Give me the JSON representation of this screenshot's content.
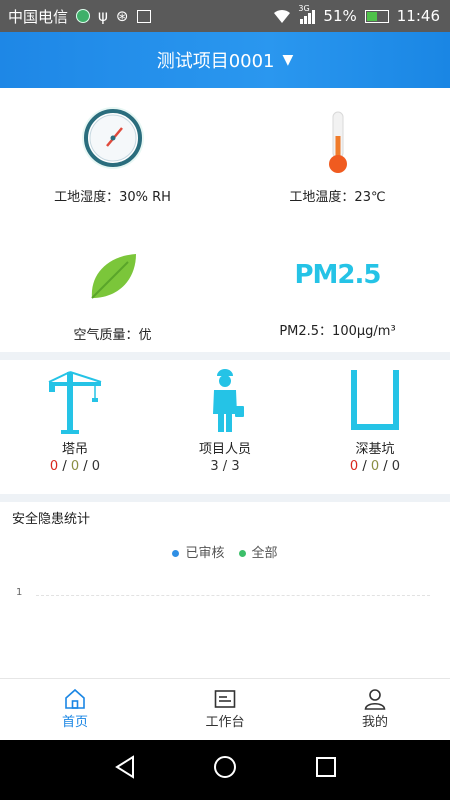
{
  "status_bar": {
    "carrier": "中国电信",
    "network": "3G",
    "battery": "51%",
    "time": "11:46"
  },
  "header": {
    "project": "测试项目0001",
    "caret": "▼"
  },
  "environment": {
    "humidity": "工地湿度：30% RH",
    "temperature": "工地温度：23℃",
    "air_quality": "空气质量：优",
    "pm25_logo": "PM2.5",
    "pm25": "PM2.5：100μg/m³"
  },
  "equipment": [
    {
      "label": "塔吊",
      "counts": [
        "0",
        "0",
        "0"
      ]
    },
    {
      "label": "项目人员",
      "counts_text": "3 / 3"
    },
    {
      "label": "深基坑",
      "counts": [
        "0",
        "0",
        "0"
      ]
    }
  ],
  "safety_chart": {
    "title": "安全隐患统计",
    "legend": [
      {
        "name": "已审核",
        "color": "#2f8fe5"
      },
      {
        "name": "全部",
        "color": "#3cbf6a"
      }
    ],
    "y_tick": "1"
  },
  "chart_data": {
    "type": "line",
    "title": "安全隐患统计",
    "series": [
      {
        "name": "已审核",
        "values": []
      },
      {
        "name": "全部",
        "values": []
      }
    ],
    "y_ticks": [
      "1"
    ],
    "grid": true,
    "legend_position": "top-center"
  },
  "tabs": [
    {
      "label": "首页",
      "active": true
    },
    {
      "label": "工作台",
      "active": false
    },
    {
      "label": "我的",
      "active": false
    }
  ],
  "colors": {
    "accent": "#1a86e4",
    "active_tab": "#1a86e4",
    "teal_icon": "#25c3e6"
  }
}
